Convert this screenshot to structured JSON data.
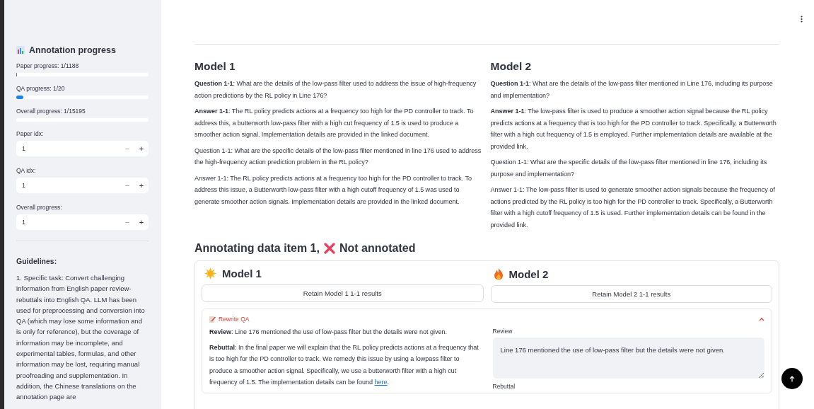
{
  "sidebar": {
    "title": "Annotation progress",
    "progress": [
      {
        "label": "Paper progress: 1/1188",
        "level": 0.001
      },
      {
        "label": "QA progress: 1/20",
        "level": 0.05
      },
      {
        "label": "Overall progress: 1/15195",
        "level": 0.0001
      }
    ],
    "number_inputs": [
      {
        "label": "Paper idx:",
        "value": "1",
        "minus": "−",
        "plus": "+",
        "minus_disabled": true
      },
      {
        "label": "QA idx:",
        "value": "1",
        "minus": "−",
        "plus": "+",
        "minus_disabled": true
      },
      {
        "label": "Overall progress:",
        "value": "1",
        "minus": "−",
        "plus": "+",
        "minus_disabled": true
      }
    ],
    "guidelines": {
      "title": "Guidelines:",
      "text": "1. Specific task: Convert challenging information from English paper review-rebuttals into English QA. LLM has been used for preprocessing and conversion into QA (which may lose some information and is only for reference), but the coverage of information may be incomplete, and experimental tables, formulas, and other information may be lost, requiring manual proofreading and supplementation. In addition, the Chinese translations on the annotation page are"
    }
  },
  "models": [
    {
      "title": "Model 1",
      "paragraphs": [
        "**Question 1-1**: What are the details of the low-pass filter used to address the issue of high-frequency action predictions by the RL policy in Line 176?",
        "**Answer 1-1**: The RL policy predicts actions at a frequency too high for the PD controller to track. To address this, a butterworth low-pass filter with a high cut frequency of 1.5 is used to produce a smoother action signal. Implementation details are provided in the linked document.",
        "Question 1-1: What are the specific details of the low-pass filter mentioned in line 176 used to address the high-frequency action prediction problem in the RL policy?",
        "Answer 1-1: The RL policy predicts actions at a frequency too high for the PD controller to track. To address this issue, a Butterworth low-pass filter with a high cutoff frequency of 1.5 was used to generate smoother action signals. Implementation details are provided in the linked document."
      ]
    },
    {
      "title": "Model 2",
      "paragraphs": [
        "**Question 1-1**: What are the details of the low-pass filter mentioned in Line 176, including its purpose and implementation?",
        "**Answer 1-1**: The low-pass filter is used to produce a smoother action signal because the RL policy predicts actions at a frequency that is too high for the PD controller to track. Specifically, a Butterworth filter with a high cut frequency of 1.5 is employed. Further implementation details are available at the provided link.",
        "Question 1-1: What are the specific details of the low-pass filter mentioned in line 176, including its purpose and implementation?",
        "Answer 1-1: The low-pass filter is used to generate smoother action signals because the frequency of actions predicted by the RL policy is too high for the PD controller to track. Specifically, a Butterworth filter with a high cutoff frequency of 1.5 is used. Further implementation details can be found in the provided link."
      ]
    }
  ],
  "annotation": {
    "heading": "Annotating data item 1,",
    "status": "Not annotated",
    "models": [
      {
        "title": "Model 1",
        "button": "Retain Model 1 1-1 results"
      },
      {
        "title": "Model 2",
        "button": "Retain Model 2 1-1 results"
      }
    ],
    "expander": {
      "title": "Rewrite QA",
      "expanded": true,
      "review": "**Review**: Line 176 mentioned the use of low-pass filter but the details were not given.",
      "rebuttal": "**Rebuttal**: In the final paper we will explain that the RL policy predicts actions at a frequency that is too high for the PD controller to track. We remedy this issue by using a lowpass filter to produce a smoother action signal. Specifically, we use a butterworth filter with a high cut frequency of 1.5. The implementation details can be found ",
      "link": "here",
      "rebuttal_end": ".",
      "fields": [
        {
          "label": "Review",
          "value": "Line 176 mentioned the use of low-pass filter but the details were not given."
        },
        {
          "label": "Rebuttal"
        }
      ]
    }
  }
}
